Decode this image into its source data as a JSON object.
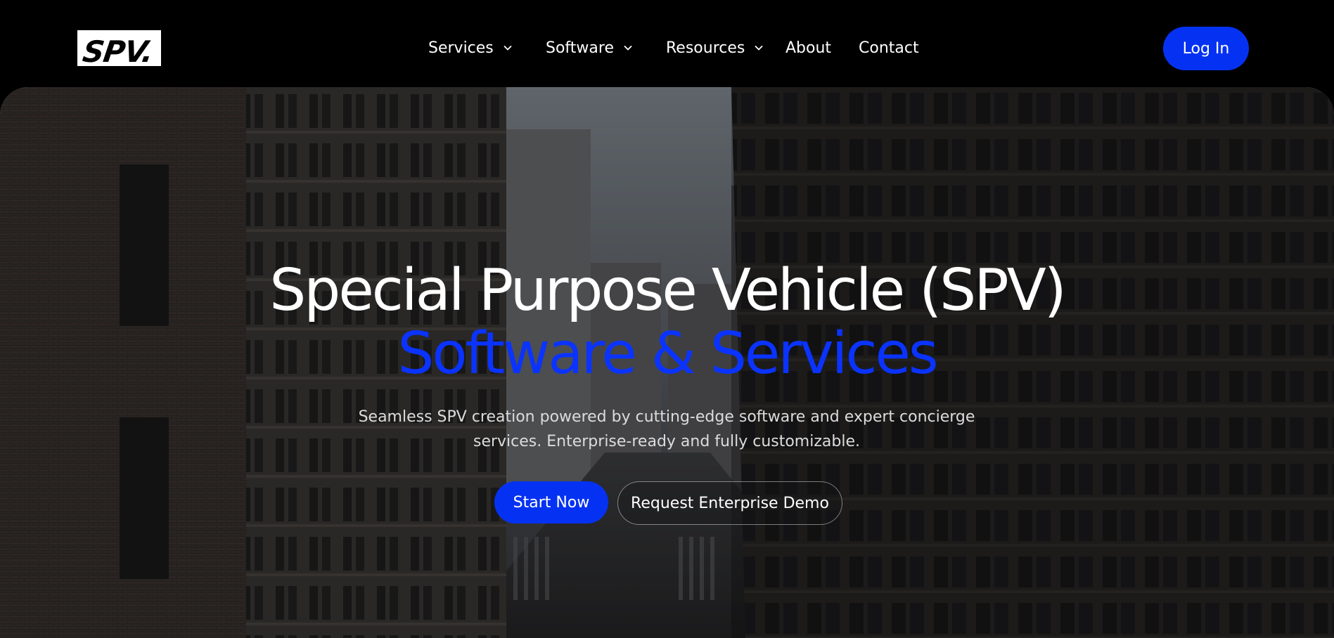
{
  "brand": {
    "logo_text": "SPV."
  },
  "nav": {
    "items": [
      {
        "label": "Services",
        "has_dropdown": true
      },
      {
        "label": "Software",
        "has_dropdown": true
      },
      {
        "label": "Resources",
        "has_dropdown": true
      },
      {
        "label": "About",
        "has_dropdown": false
      },
      {
        "label": "Contact",
        "has_dropdown": false
      }
    ],
    "login_label": "Log In"
  },
  "hero": {
    "title": "Special Purpose Vehicle (SPV)",
    "title_accent": "Software & Services",
    "subtitle_line1": "Seamless SPV creation powered by cutting-edge software and expert concierge",
    "subtitle_line2": "services. Enterprise-ready and fully customizable.",
    "primary_cta": "Start Now",
    "secondary_cta": "Request Enterprise Demo"
  },
  "colors": {
    "accent": "#0532f2",
    "accent_text": "#0a33ff",
    "header_bg": "#000000",
    "text": "#ffffff"
  },
  "icons": {
    "dropdown": "chevron-down-icon"
  }
}
